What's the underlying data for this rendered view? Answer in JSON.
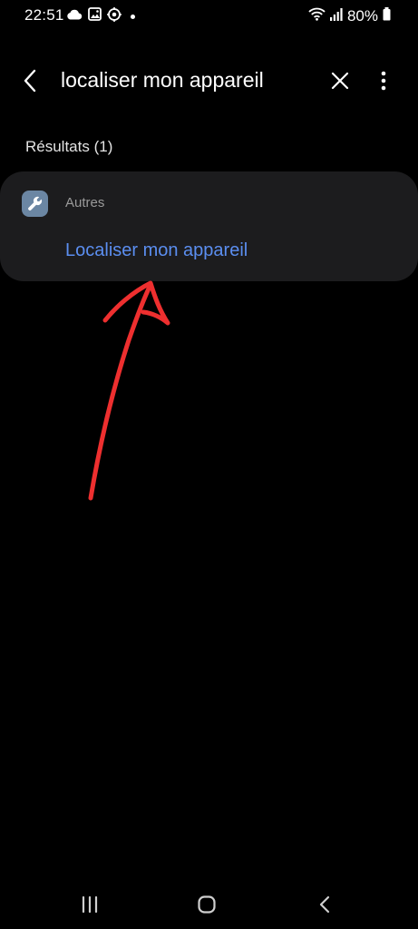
{
  "status_bar": {
    "time": "22:51",
    "battery": "80%",
    "icons_left": [
      "cloud-icon",
      "image-icon",
      "location-target-icon",
      "notification-dot"
    ],
    "icons_right": [
      "wifi-icon",
      "signal-icon",
      "battery-icon"
    ]
  },
  "header": {
    "query": "localiser mon appareil",
    "icons": [
      "back-arrow-icon",
      "close-icon",
      "more-vertical-icon"
    ]
  },
  "results": {
    "count_label": "Résultats (1)",
    "items": [
      {
        "category": "Autres",
        "category_icon": "wrench-icon",
        "title": "Localiser mon appareil"
      }
    ]
  },
  "nav_bar": {
    "icons": [
      "recents-icon",
      "home-icon",
      "back-icon"
    ]
  },
  "colors": {
    "background": "#000000",
    "card": "#1c1c1e",
    "link": "#5b8ef0",
    "category_icon_bg": "#6b86a3",
    "annotation": "#ee2f2f"
  }
}
